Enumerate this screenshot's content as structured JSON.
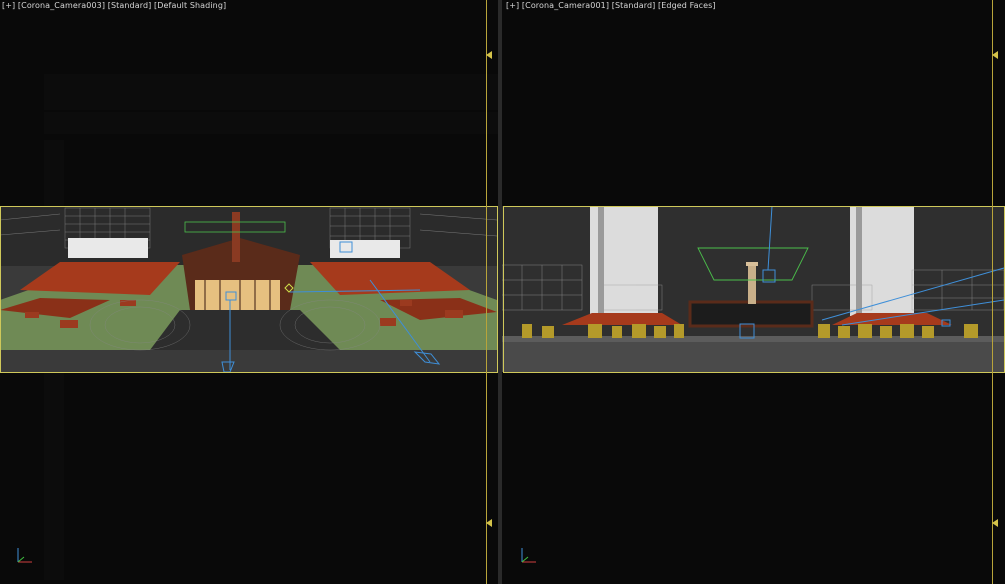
{
  "viewports": {
    "left": {
      "plus": "[+]",
      "camera": "[Corona_Camera003]",
      "view": "[Standard]",
      "shading": "[Default Shading]"
    },
    "right": {
      "plus": "[+]",
      "camera": "[Corona_Camera001]",
      "view": "[Standard]",
      "shading": "[Edged Faces]"
    }
  },
  "colors": {
    "safe_frame": "#cfc85a",
    "camera_target": "#3f8fd8",
    "roof": "#a63a1c",
    "grass": "#6f8a55",
    "foliage": "#b49a2a"
  },
  "icons": {
    "axis": "xyz-axis-gizmo-icon",
    "frame_handle": "safe-frame-arrow-icon"
  }
}
